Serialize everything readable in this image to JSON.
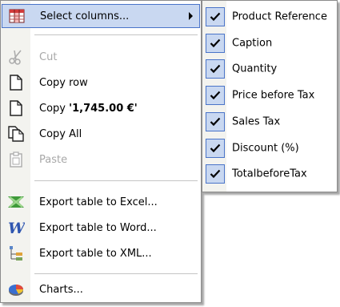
{
  "menu": {
    "select_columns": "Select columns...",
    "cut": "Cut",
    "copy_row": "Copy row",
    "copy_value_prefix": "Copy ",
    "copy_value": "'1,745.00 €'",
    "copy_all": "Copy All",
    "paste": "Paste",
    "export_excel": "Export table to Excel...",
    "export_word": "Export table to Word...",
    "export_xml": "Export table to XML...",
    "charts": "Charts..."
  },
  "columns": [
    {
      "label": "Product Reference",
      "checked": true
    },
    {
      "label": "Caption",
      "checked": true
    },
    {
      "label": "Quantity",
      "checked": true
    },
    {
      "label": "Price before Tax",
      "checked": true
    },
    {
      "label": "Sales Tax",
      "checked": true
    },
    {
      "label": "Discount (%)",
      "checked": true
    },
    {
      "label": "TotalbeforeTax",
      "checked": true
    }
  ],
  "colors": {
    "highlight": "#c9d8f1",
    "highlight_border": "#4a74c9",
    "disabled_text": "#a8a8a8",
    "gutter": "#f3f3ef"
  },
  "icons": {
    "select_columns": "columns-icon",
    "cut": "scissors-icon",
    "copy_row": "page-icon",
    "copy_value": "page-icon",
    "copy_all": "pages-icon",
    "paste": "clipboard-icon",
    "export_excel": "excel-icon",
    "export_word": "word-icon",
    "export_xml": "xml-icon",
    "charts": "pie-chart-icon"
  }
}
